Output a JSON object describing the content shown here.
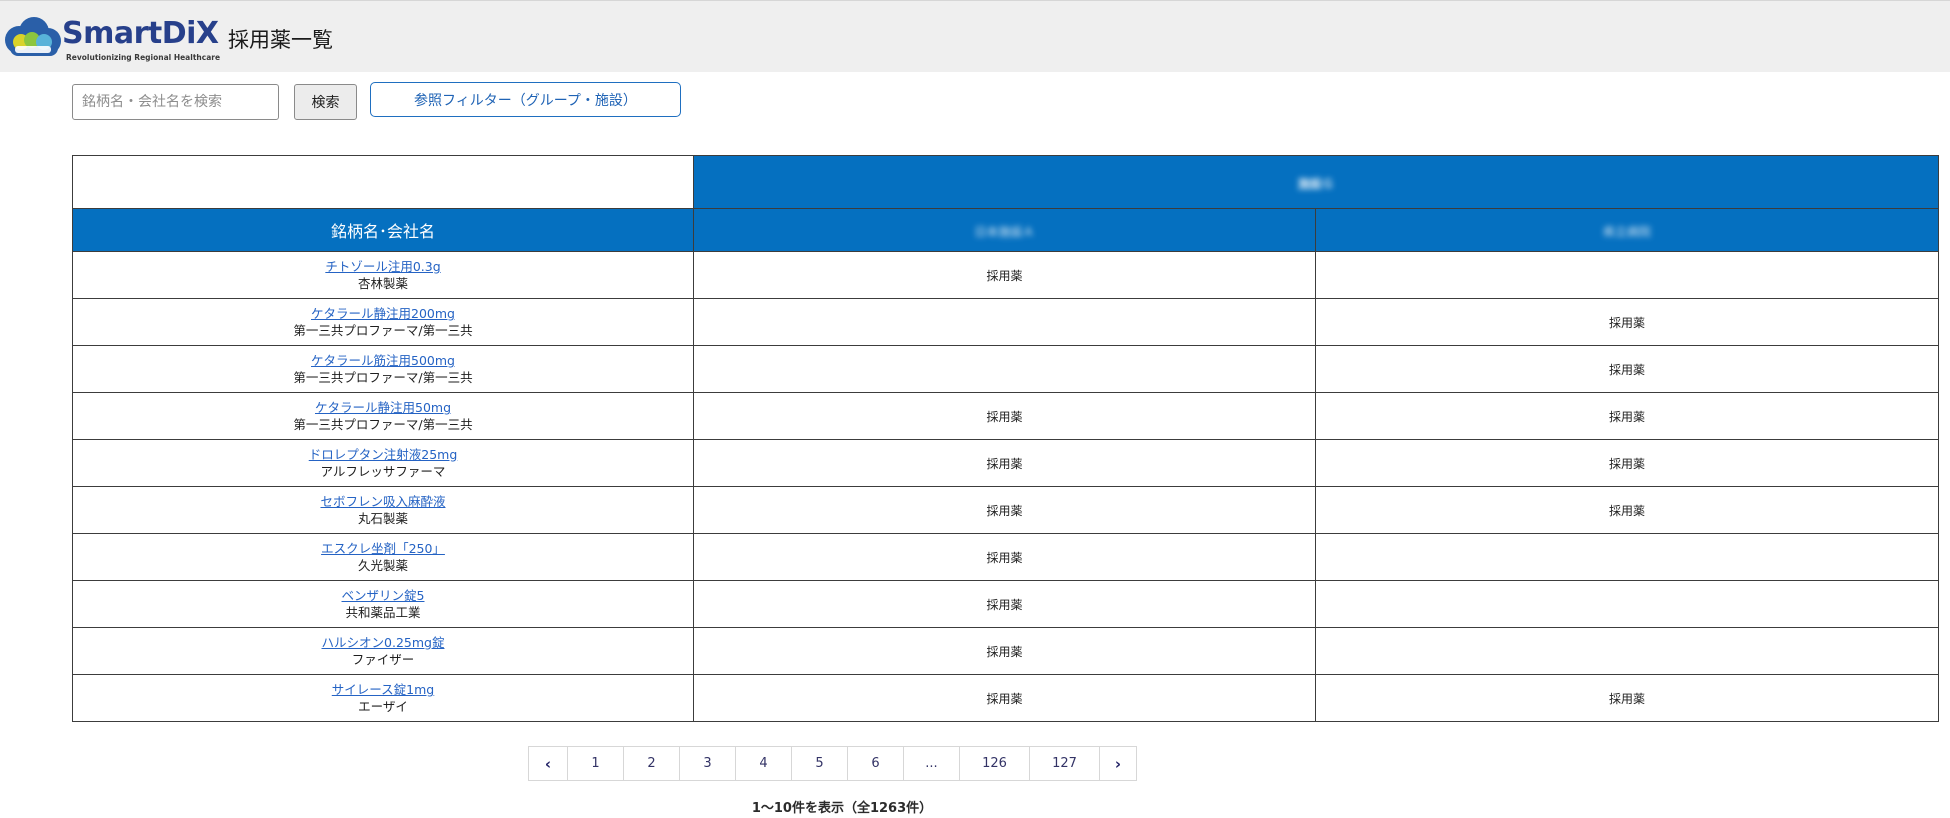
{
  "app": {
    "logo_text": "SmartDiX",
    "logo_tagline": "Revolutionizing Regional Healthcare",
    "page_title": "採用薬一覧"
  },
  "search": {
    "placeholder": "銘柄名・会社名を検索",
    "value": "",
    "button_label": "検索",
    "filter_label": "参照フィルター（グループ・施設）"
  },
  "table": {
    "group_header": "施設Ｇ",
    "name_header": "銘柄名･会社名",
    "facility_headers": [
      "日本施設Ａ",
      "県立病院"
    ],
    "rows": [
      {
        "drug": "チトゾール注用0.3g",
        "company": "杏林製薬",
        "f1": "採用薬",
        "f2": ""
      },
      {
        "drug": "ケタラール静注用200mg",
        "company": "第一三共プロファーマ/第一三共",
        "f1": "",
        "f2": "採用薬"
      },
      {
        "drug": "ケタラール筋注用500mg",
        "company": "第一三共プロファーマ/第一三共",
        "f1": "",
        "f2": "採用薬"
      },
      {
        "drug": "ケタラール静注用50mg",
        "company": "第一三共プロファーマ/第一三共",
        "f1": "採用薬",
        "f2": "採用薬"
      },
      {
        "drug": "ドロレプタン注射液25mg",
        "company": "アルフレッサファーマ",
        "f1": "採用薬",
        "f2": "採用薬"
      },
      {
        "drug": "セボフレン吸入麻酔液",
        "company": "丸石製薬",
        "f1": "採用薬",
        "f2": "採用薬"
      },
      {
        "drug": "エスクレ坐剤「250」",
        "company": "久光製薬",
        "f1": "採用薬",
        "f2": ""
      },
      {
        "drug": "ベンザリン錠5",
        "company": "共和薬品工業",
        "f1": "採用薬",
        "f2": ""
      },
      {
        "drug": "ハルシオン0.25mg錠",
        "company": "ファイザー",
        "f1": "採用薬",
        "f2": ""
      },
      {
        "drug": "サイレース錠1mg",
        "company": "エーザイ",
        "f1": "採用薬",
        "f2": "採用薬"
      }
    ]
  },
  "pagination": {
    "prev": "‹",
    "next": "›",
    "pages": [
      "1",
      "2",
      "3",
      "4",
      "5",
      "6",
      "...",
      "126",
      "127"
    ],
    "current": "1"
  },
  "result_count": "1〜10件を表示（全1263件）",
  "colors": {
    "header_blue": "#0570c0",
    "link_blue": "#2563c4",
    "brand_navy": "#27408b"
  }
}
